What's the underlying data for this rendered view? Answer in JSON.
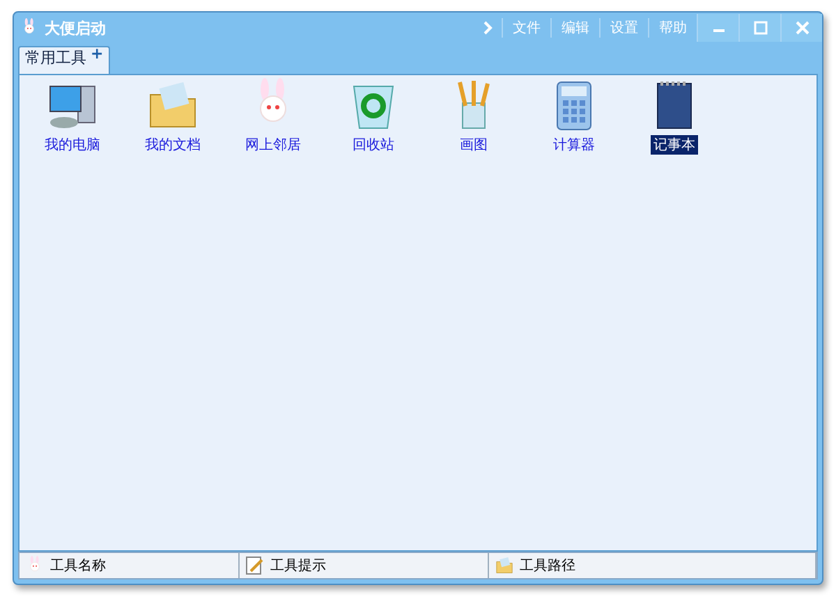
{
  "window": {
    "title": "大便启动"
  },
  "menu": [
    "文件",
    "编辑",
    "设置",
    "帮助"
  ],
  "tabs": [
    {
      "label": "常用工具",
      "selected": true,
      "add": "+"
    }
  ],
  "tools": [
    {
      "label": "我的电脑",
      "kind": "computer",
      "selected": false
    },
    {
      "label": "我的文档",
      "kind": "folder",
      "selected": false
    },
    {
      "label": "网上邻居",
      "kind": "rabbit",
      "selected": false
    },
    {
      "label": "回收站",
      "kind": "recycle",
      "selected": false
    },
    {
      "label": "画图",
      "kind": "paint",
      "selected": false
    },
    {
      "label": "计算器",
      "kind": "calculator",
      "selected": false
    },
    {
      "label": "记事本",
      "kind": "notepad",
      "selected": true
    }
  ],
  "status_bar": [
    {
      "label": "工具名称",
      "kind": "rabbit"
    },
    {
      "label": "工具提示",
      "kind": "note"
    },
    {
      "label": "工具路径",
      "kind": "folder"
    }
  ]
}
